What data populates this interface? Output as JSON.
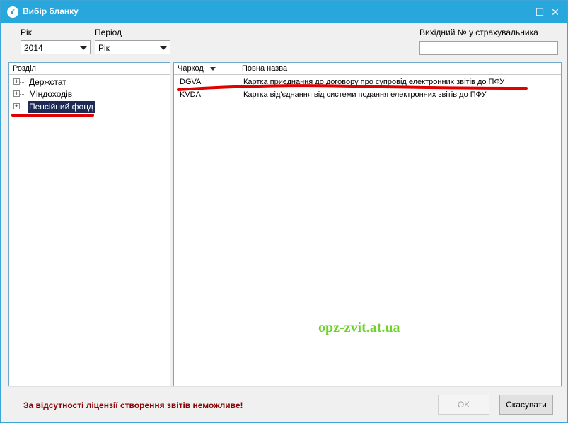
{
  "window": {
    "title": "Вибір бланку",
    "minimize_glyph": "—",
    "maximize_glyph": "☐",
    "close_glyph": "✕"
  },
  "filters": {
    "year_label": "Рік",
    "year_value": "2014",
    "period_label": "Період",
    "period_value": "Рік",
    "outgoing_label": "Вихідний № у страхувальника",
    "outgoing_value": ""
  },
  "tree": {
    "header": "Розділ",
    "items": [
      {
        "label": "Держстат",
        "selected": false
      },
      {
        "label": "Міндоходів",
        "selected": false
      },
      {
        "label": "Пенсійний фонд",
        "selected": true
      }
    ]
  },
  "grid": {
    "columns": [
      "Чаркод",
      "Повна назва"
    ],
    "rows": [
      {
        "code": "DGVA",
        "name": "Картка приєднання до договору про супровід електронних звітів до ПФУ"
      },
      {
        "code": "KVDA",
        "name": "Картка від'єднання від системи подання електронних звітів до ПФУ"
      }
    ]
  },
  "watermark": "opz-zvit.at.ua",
  "footer": {
    "warning": "За відсутності ліцензії створення звітів неможливе!",
    "ok_label": "OK",
    "cancel_label": "Скасувати"
  },
  "colors": {
    "titlebar": "#27a7dc",
    "selection": "#1e2a56",
    "annotation_red": "#e00000",
    "warning_text": "#8b0000",
    "watermark": "#6fd12a"
  },
  "icons": {
    "app": "app-logo-icon",
    "sort": "sort-down-icon",
    "expand": "expand-plus-icon",
    "dropdown": "chevron-down-icon"
  }
}
